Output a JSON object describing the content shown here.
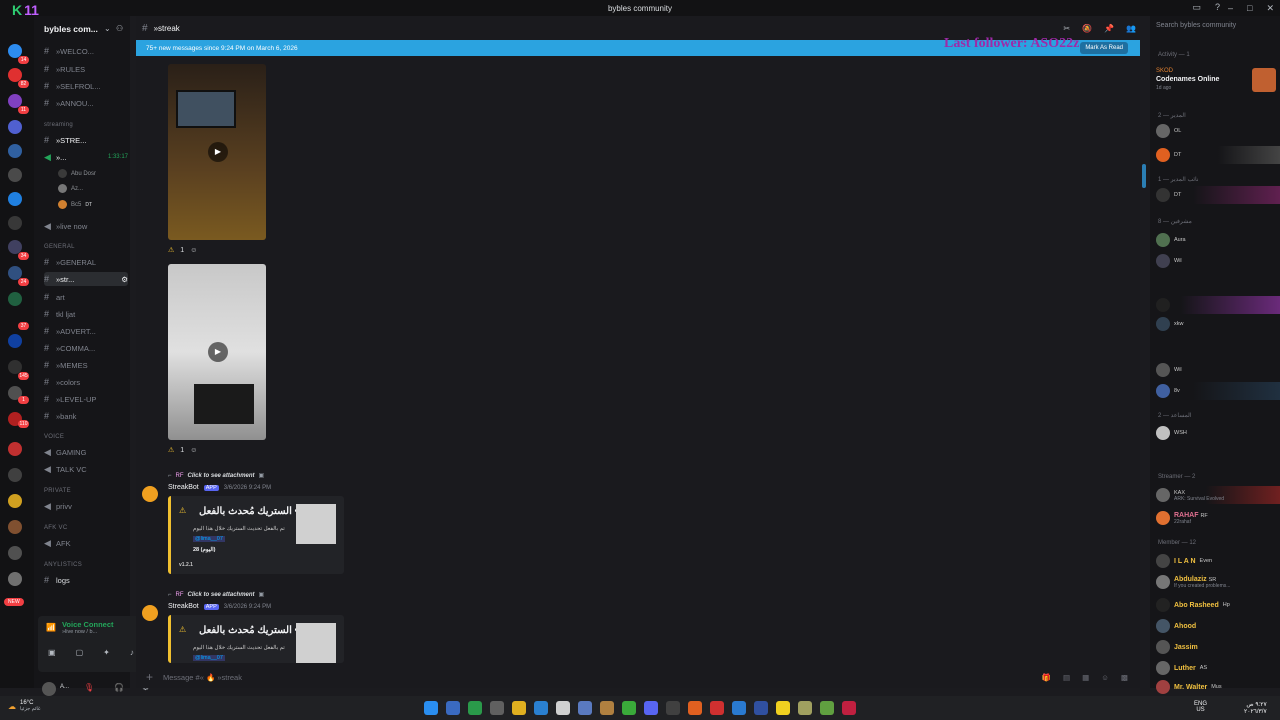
{
  "window": {
    "title": "bybles community",
    "logo_text": "K",
    "logo_num": "11"
  },
  "server": {
    "name": "bybles com..."
  },
  "rail_badges": [
    "14",
    "82",
    "11",
    "34",
    "24",
    "37",
    "145",
    "1",
    "110"
  ],
  "channels": [
    {
      "label": "»WELCO..."
    },
    {
      "label": "»RULES"
    },
    {
      "label": "»SELFROL..."
    },
    {
      "label": "»ANNOU..."
    }
  ],
  "categories": {
    "streaming": "streaming",
    "general": "GENERAL",
    "voice": "VOICE",
    "private": "PRIVATE",
    "afk": "AFK VC",
    "anylistics": "ANYLISTICS"
  },
  "streaming_channels": [
    {
      "label": "»STRE..."
    },
    {
      "label": "»..."
    }
  ],
  "live_time": "1:33:17",
  "voice_users": [
    "Abu Dosr",
    "Az...",
    "Bc5"
  ],
  "voice_user_tag": "DT",
  "live_now": "»live now",
  "general_channels": [
    "»GENERAL",
    "»str...",
    "art",
    "tkl ljat",
    "»ADVERT...",
    "»COMMA...",
    "»MEMES",
    "»colors",
    "»LEVEL-UP",
    "»bank"
  ],
  "voice_channels": [
    "GAMING",
    "TALK VC"
  ],
  "private_channels": [
    "privv"
  ],
  "afk_channels": [
    "AFK"
  ],
  "anylistics_channels": [
    "logs"
  ],
  "new_badge": "NEW",
  "voice_connect": {
    "title": "Voice Connect",
    "sub": "»live now / b..."
  },
  "current_user": "A...",
  "channel_header": "»streak",
  "new_messages_text": "75+ new messages since 9:24 PM on March 6, 2026",
  "mark_as_read": "Mark As Read",
  "overlay_text": "Last follower: ASO22z",
  "reaction_count_1": "1",
  "reaction_count_2": "1",
  "messages": [
    {
      "reply_tag": "RF",
      "reply_text": "Click to see attachment",
      "author": "StreakBot",
      "app_tag": "APP",
      "time": "3/6/2026 9:24 PM",
      "embed_title": "الستريك مُحدث بالفعل •",
      "line1": "تم بالفعل تحديث الستريك خلال هذا اليوم",
      "mention": "@lima__07",
      "count_line": "28 (اليوم)",
      "version": "v1.2.1"
    },
    {
      "reply_tag": "RF",
      "reply_text": "Click to see attachment",
      "author": "StreakBot",
      "app_tag": "APP",
      "time": "3/6/2026 9:24 PM",
      "embed_title": "الستريك مُحدث بالفعل •",
      "line1": "تم بالفعل تحديث الستريك خلال هذا اليوم",
      "mention": "@lima__07"
    }
  ],
  "composer_placeholder": "Message #« 🔥 »streak",
  "members": {
    "search": "Search bybles community",
    "activity_label": "Activity — 1",
    "activity": {
      "user": "SKOD",
      "game": "Codenames Online",
      "time": "1d ago"
    },
    "cat1": "المدير — 2",
    "cat2": "نائب المدير — 1",
    "cat3": "مشرفين — 8",
    "cat4": "المساعد — 2",
    "cat5": "Streamer — 2",
    "cat6": "Member — 12",
    "roles1": [
      "OL",
      "DT"
    ],
    "roles3": [
      "Aura",
      "Wil",
      "",
      "xkw",
      "",
      "Wil",
      "8v"
    ],
    "list": [
      {
        "name": "I L A N",
        "tag": "Even"
      },
      {
        "name": "Abdulaziz",
        "tag": "SR",
        "sub": "If you created problems..."
      },
      {
        "name": "Abo Rasheed",
        "tag": "Hp"
      },
      {
        "name": "Ahood",
        "tag": ""
      },
      {
        "name": "Jassim",
        "tag": ""
      },
      {
        "name": "Luther",
        "tag": "AS"
      },
      {
        "name": "Mr. Walter",
        "tag": "Mus"
      }
    ],
    "streamers": [
      {
        "name": "",
        "tag": "KAX",
        "sub": "ARK: Survival Evolved"
      },
      {
        "name": "RAHAF",
        "tag": "RF",
        "sub": "22rahaf"
      }
    ],
    "assist": [
      {
        "tag": "WSH"
      }
    ],
    "vp_tag": "DT"
  },
  "taskbar": {
    "weather": "16°C",
    "weather_sub": "غائم جزئيا",
    "lang": "ENG",
    "region": "US",
    "time": "٩:٢٧ ص",
    "date": "٢٠٢٦/٣/٧"
  }
}
